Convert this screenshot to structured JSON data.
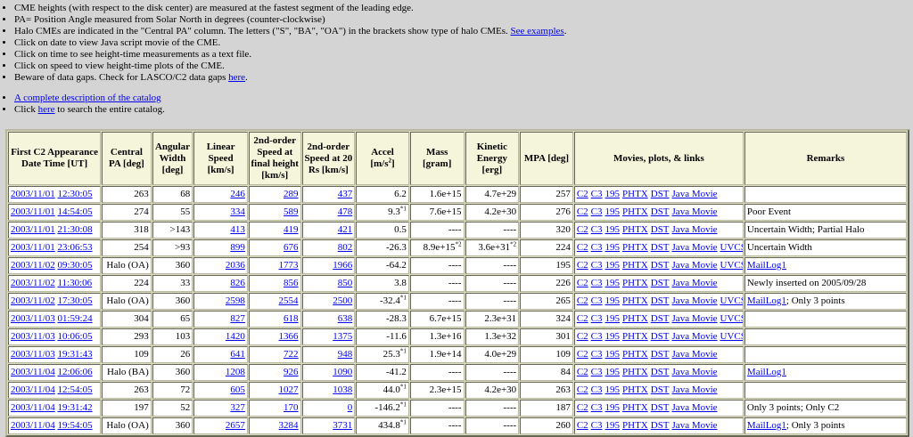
{
  "notes": [
    "CME heights (with respect to the disk center) are measured at the fastest segment of the leading edge.",
    "PA= Position Angle measured from Solar North in degrees (counter-clockwise)",
    {
      "text": "Halo CMEs are indicated in the \"Central PA\" column. The letters (\"S\", \"BA\", \"OA\") in the brackets show type of halo CMEs. ",
      "link": "See examples",
      "after": "."
    },
    "Click on date to view Java script movie of the CME.",
    "Click on time to see height-time measurements as a text file.",
    "Click on speed to view height-time plots of the CME.",
    {
      "text": "Beware of data gaps. Check for LASCO/C2 data gaps ",
      "link": "here",
      "after": "."
    }
  ],
  "notes2": [
    {
      "link": "A complete description of the catalog"
    },
    {
      "text": "Click ",
      "link": "here",
      "after": " to search the entire catalog."
    }
  ],
  "columns": [
    "First C2 Appearance Date Time [UT]",
    "Central PA [deg]",
    "Angular Width [deg]",
    "Linear Speed [km/s]",
    "2nd-order Speed at final height [km/s]",
    "2nd-order Speed at 20 Rs [km/s]",
    "Accel [m/s2]",
    "Mass [gram]",
    "Kinetic Energy [erg]",
    "MPA [deg]",
    "Movies, plots, & links",
    "Remarks"
  ],
  "rows": [
    {
      "date": "2003/11/01",
      "time": "12:30:05",
      "cpa": "263",
      "width": "68",
      "speed": "246",
      "sp_final": "289",
      "sp_20": "437",
      "accel": "6.2",
      "accel_note": "",
      "mass": "1.6e+15",
      "mass_note": "",
      "ke": "4.7e+29",
      "ke_note": "",
      "mpa": "257",
      "links": [
        "C2",
        "C3",
        "195",
        "PHTX",
        "DST",
        "Java Movie"
      ],
      "remark": "",
      "remark_link": ""
    },
    {
      "date": "2003/11/01",
      "time": "14:54:05",
      "cpa": "274",
      "width": "55",
      "speed": "334",
      "sp_final": "589",
      "sp_20": "478",
      "accel": "9.3",
      "accel_note": "*1",
      "mass": "7.6e+15",
      "mass_note": "",
      "ke": "4.2e+30",
      "ke_note": "",
      "mpa": "276",
      "links": [
        "C2",
        "C3",
        "195",
        "PHTX",
        "DST",
        "Java Movie"
      ],
      "remark": "Poor Event",
      "remark_link": ""
    },
    {
      "date": "2003/11/01",
      "time": "21:30:08",
      "cpa": "318",
      "width": ">143",
      "speed": "413",
      "sp_final": "419",
      "sp_20": "421",
      "accel": "0.5",
      "accel_note": "",
      "mass": "----",
      "mass_note": "",
      "ke": "----",
      "ke_note": "",
      "mpa": "320",
      "links": [
        "C2",
        "C3",
        "195",
        "PHTX",
        "DST",
        "Java Movie"
      ],
      "remark": "Uncertain Width; Partial Halo",
      "remark_link": ""
    },
    {
      "date": "2003/11/01",
      "time": "23:06:53",
      "cpa": "254",
      "width": ">93",
      "speed": "899",
      "sp_final": "676",
      "sp_20": "802",
      "accel": "-26.3",
      "accel_note": "",
      "mass": "8.9e+15",
      "mass_note": "*2",
      "ke": "3.6e+31",
      "ke_note": "*2",
      "mpa": "224",
      "links": [
        "C2",
        "C3",
        "195",
        "PHTX",
        "DST",
        "Java Movie",
        "UVCS"
      ],
      "remark": "Uncertain Width",
      "remark_link": ""
    },
    {
      "date": "2003/11/02",
      "time": "09:30:05",
      "cpa": "Halo (OA)",
      "width": "360",
      "speed": "2036",
      "sp_final": "1773",
      "sp_20": "1966",
      "accel": "-64.2",
      "accel_note": "",
      "mass": "----",
      "mass_note": "",
      "ke": "----",
      "ke_note": "",
      "mpa": "195",
      "links": [
        "C2",
        "C3",
        "195",
        "PHTX",
        "DST",
        "Java Movie",
        "UVCS"
      ],
      "remark": "",
      "remark_link": "MailLog1"
    },
    {
      "date": "2003/11/02",
      "time": "11:30:06",
      "cpa": "224",
      "width": "33",
      "speed": "826",
      "sp_final": "856",
      "sp_20": "850",
      "accel": "3.8",
      "accel_note": "",
      "mass": "----",
      "mass_note": "",
      "ke": "----",
      "ke_note": "",
      "mpa": "226",
      "links": [
        "C2",
        "C3",
        "195",
        "PHTX",
        "DST",
        "Java Movie"
      ],
      "remark": "Newly inserted on 2005/09/28",
      "remark_link": ""
    },
    {
      "date": "2003/11/02",
      "time": "17:30:05",
      "cpa": "Halo (OA)",
      "width": "360",
      "speed": "2598",
      "sp_final": "2554",
      "sp_20": "2500",
      "accel": "-32.4",
      "accel_note": "*1",
      "mass": "----",
      "mass_note": "",
      "ke": "----",
      "ke_note": "",
      "mpa": "265",
      "links": [
        "C2",
        "C3",
        "195",
        "PHTX",
        "DST",
        "Java Movie",
        "UVCS"
      ],
      "remark": "; Only 3 points",
      "remark_link": "MailLog1"
    },
    {
      "date": "2003/11/03",
      "time": "01:59:24",
      "cpa": "304",
      "width": "65",
      "speed": "827",
      "sp_final": "618",
      "sp_20": "638",
      "accel": "-28.3",
      "accel_note": "",
      "mass": "6.7e+15",
      "mass_note": "",
      "ke": "2.3e+31",
      "ke_note": "",
      "mpa": "324",
      "links": [
        "C2",
        "C3",
        "195",
        "PHTX",
        "DST",
        "Java Movie",
        "UVCS"
      ],
      "remark": "",
      "remark_link": ""
    },
    {
      "date": "2003/11/03",
      "time": "10:06:05",
      "cpa": "293",
      "width": "103",
      "speed": "1420",
      "sp_final": "1366",
      "sp_20": "1375",
      "accel": "-11.6",
      "accel_note": "",
      "mass": "1.3e+16",
      "mass_note": "",
      "ke": "1.3e+32",
      "ke_note": "",
      "mpa": "301",
      "links": [
        "C2",
        "C3",
        "195",
        "PHTX",
        "DST",
        "Java Movie",
        "UVCS"
      ],
      "remark": "",
      "remark_link": ""
    },
    {
      "date": "2003/11/03",
      "time": "19:31:43",
      "cpa": "109",
      "width": "26",
      "speed": "641",
      "sp_final": "722",
      "sp_20": "948",
      "accel": "25.3",
      "accel_note": "*1",
      "mass": "1.9e+14",
      "mass_note": "",
      "ke": "4.0e+29",
      "ke_note": "",
      "mpa": "109",
      "links": [
        "C2",
        "C3",
        "195",
        "PHTX",
        "DST",
        "Java Movie"
      ],
      "remark": "",
      "remark_link": ""
    },
    {
      "date": "2003/11/04",
      "time": "12:06:06",
      "cpa": "Halo (BA)",
      "width": "360",
      "speed": "1208",
      "sp_final": "926",
      "sp_20": "1090",
      "accel": "-41.2",
      "accel_note": "",
      "mass": "----",
      "mass_note": "",
      "ke": "----",
      "ke_note": "",
      "mpa": "84",
      "links": [
        "C2",
        "C3",
        "195",
        "PHTX",
        "DST",
        "Java Movie"
      ],
      "remark": "",
      "remark_link": "MailLog1"
    },
    {
      "date": "2003/11/04",
      "time": "12:54:05",
      "cpa": "263",
      "width": "72",
      "speed": "605",
      "sp_final": "1027",
      "sp_20": "1038",
      "accel": "44.0",
      "accel_note": "*1",
      "mass": "2.3e+15",
      "mass_note": "",
      "ke": "4.2e+30",
      "ke_note": "",
      "mpa": "263",
      "links": [
        "C2",
        "C3",
        "195",
        "PHTX",
        "DST",
        "Java Movie"
      ],
      "remark": "",
      "remark_link": ""
    },
    {
      "date": "2003/11/04",
      "time": "19:31:42",
      "cpa": "197",
      "width": "52",
      "speed": "327",
      "sp_final": "170",
      "sp_20": "0",
      "accel": "-146.2",
      "accel_note": "*1",
      "mass": "----",
      "mass_note": "",
      "ke": "----",
      "ke_note": "",
      "mpa": "187",
      "links": [
        "C2",
        "C3",
        "195",
        "PHTX",
        "DST",
        "Java Movie"
      ],
      "remark": "Only 3 points; Only C2",
      "remark_link": ""
    },
    {
      "date": "2003/11/04",
      "time": "19:54:05",
      "cpa": "Halo (OA)",
      "width": "360",
      "speed": "2657",
      "sp_final": "3284",
      "sp_20": "3731",
      "accel": "434.8",
      "accel_note": "*1",
      "mass": "----",
      "mass_note": "",
      "ke": "----",
      "ke_note": "",
      "mpa": "260",
      "links": [
        "C2",
        "C3",
        "195",
        "PHTX",
        "DST",
        "Java Movie"
      ],
      "remark": "; Only 3 points",
      "remark_link": "MailLog1"
    }
  ]
}
